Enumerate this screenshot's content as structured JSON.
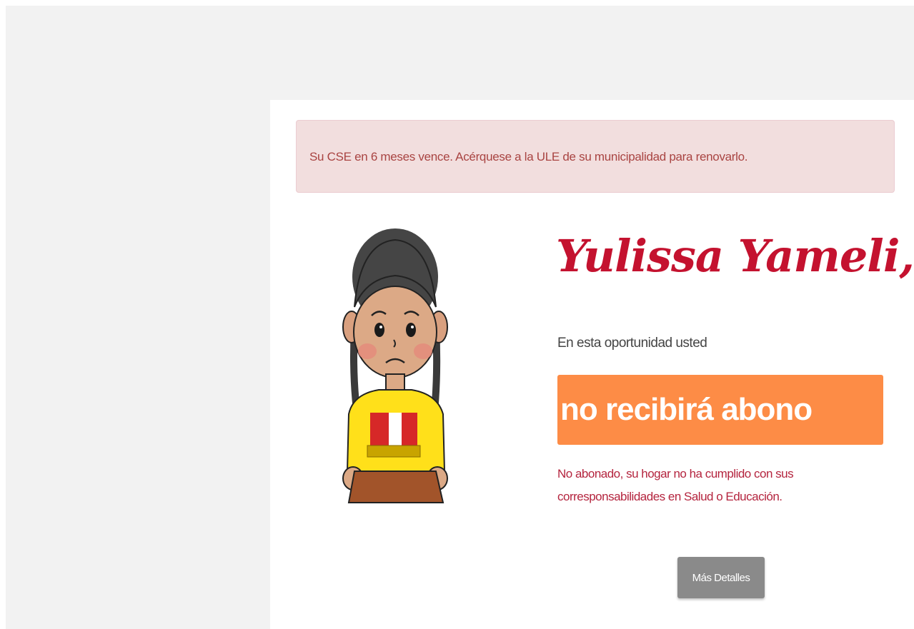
{
  "alert": {
    "message": "Su CSE en 6 meses vence. Acérquese a la ULE de su municipalidad para renovarlo."
  },
  "beneficiary": {
    "name_greeting": "Yulissa Yameli,",
    "intro_text": "En esta oportunidad usted",
    "status_text": "no recibirá abono",
    "reason_text": "No abonado, su hogar no ha cumplido con sus corresponsabilidades en Salud o Educación."
  },
  "actions": {
    "details_label": "Más Detalles"
  },
  "illustration": {
    "icon": "sad-girl-illustration"
  },
  "colors": {
    "alert_bg": "#f2dede",
    "alert_text": "#a94442",
    "greeting": "#c4122f",
    "status_bg": "#fd8c46",
    "reason_text": "#b4243e",
    "button_bg": "#8a8a8a"
  }
}
